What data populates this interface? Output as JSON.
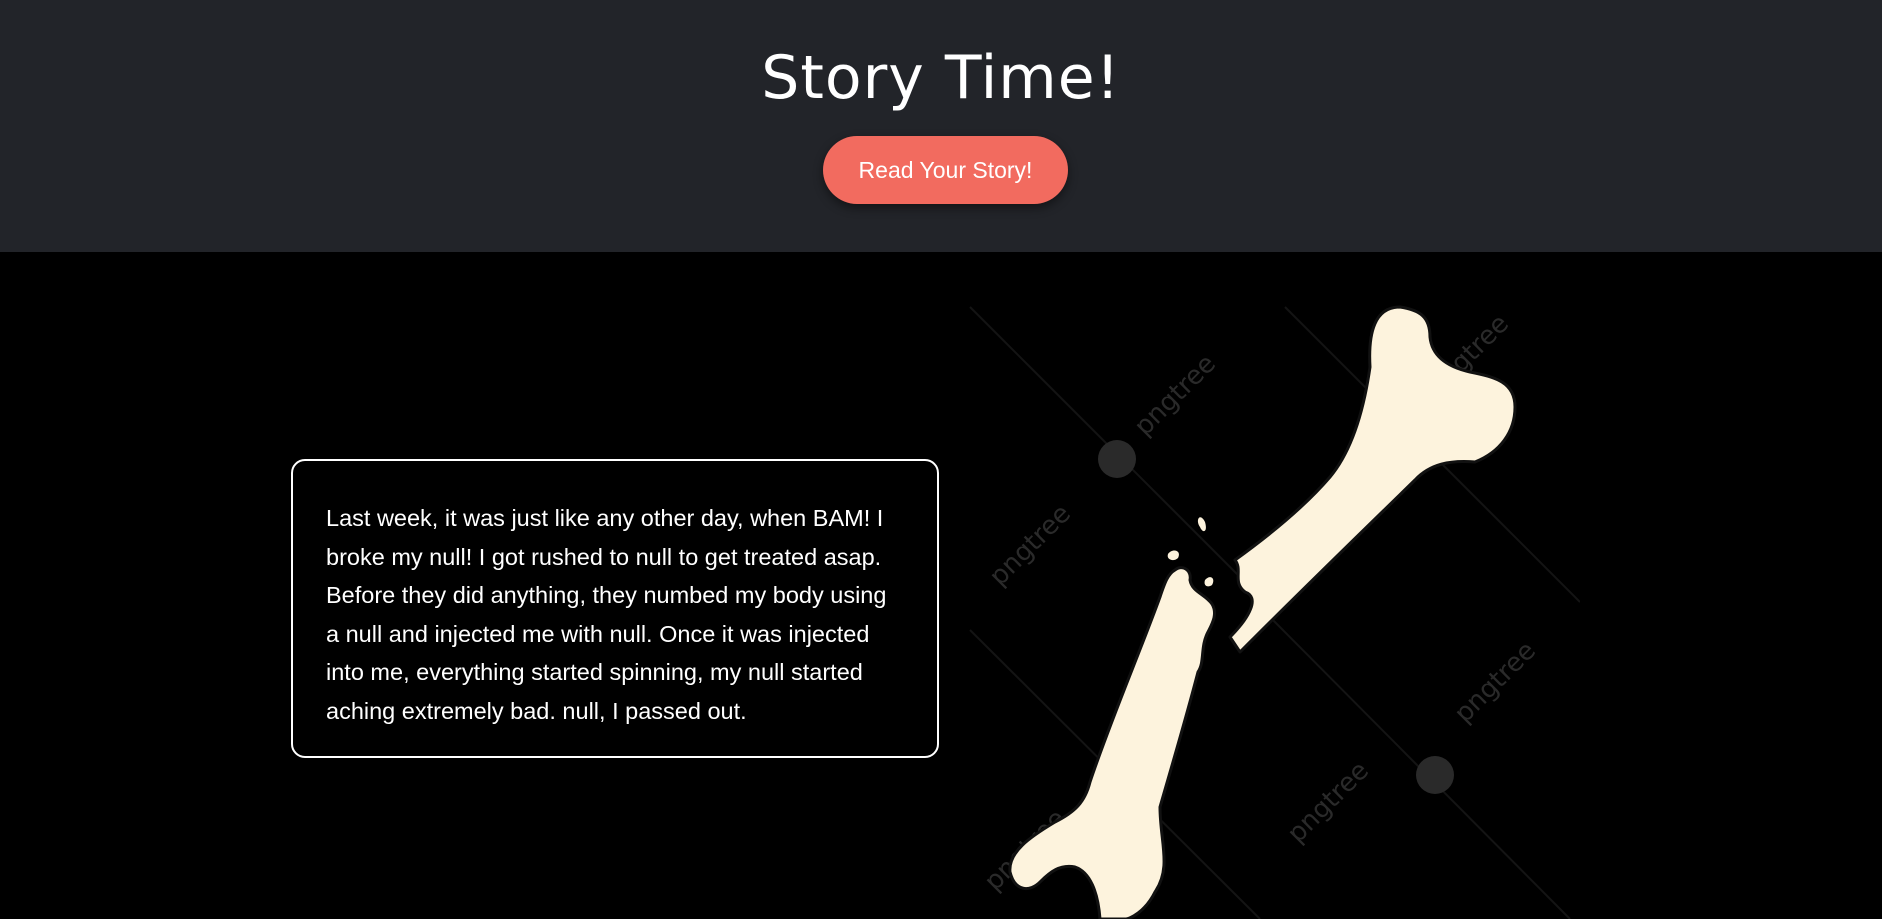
{
  "header": {
    "title": "Story Time!",
    "button_label": "Read Your Story!"
  },
  "story": {
    "text": "Last week, it was just like any other day, when BAM! I broke my null! I got rushed to null to get treated asap. Before they did anything, they numbed my body using a null and injected me with null. Once it was injected into me, everything started spinning, my null started aching extremely bad. null, I passed out."
  },
  "image": {
    "watermark_text": "pngtree",
    "icon": "broken-bone-icon"
  },
  "colors": {
    "header_bg": "#222429",
    "page_bg": "#000000",
    "button_bg": "#f26b5f",
    "bone_fill": "#fdf3dd",
    "text": "#ffffff"
  }
}
